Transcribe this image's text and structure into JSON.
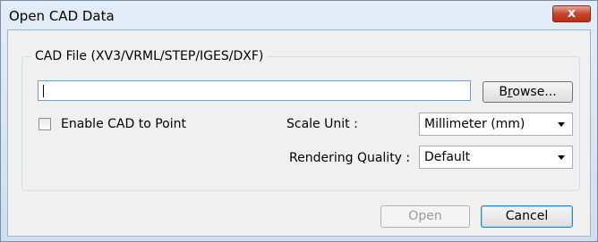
{
  "window": {
    "title": "Open CAD Data",
    "close_glyph": "x"
  },
  "cad_file": {
    "group_label": "CAD File (XV3/VRML/STEP/IGES/DXF)",
    "path_value": "",
    "browse_prefix": "B",
    "browse_mnemonic": "r",
    "browse_suffix": "owse..."
  },
  "options": {
    "enable_cad_label": "Enable CAD to Point",
    "enable_cad_checked": false,
    "scale_unit_label": "Scale Unit :",
    "scale_unit_value": "Millimeter (mm)",
    "rendering_quality_label": "Rendering Quality :",
    "rendering_quality_value": "Default"
  },
  "buttons": {
    "open_label": "Open",
    "cancel_label": "Cancel"
  }
}
